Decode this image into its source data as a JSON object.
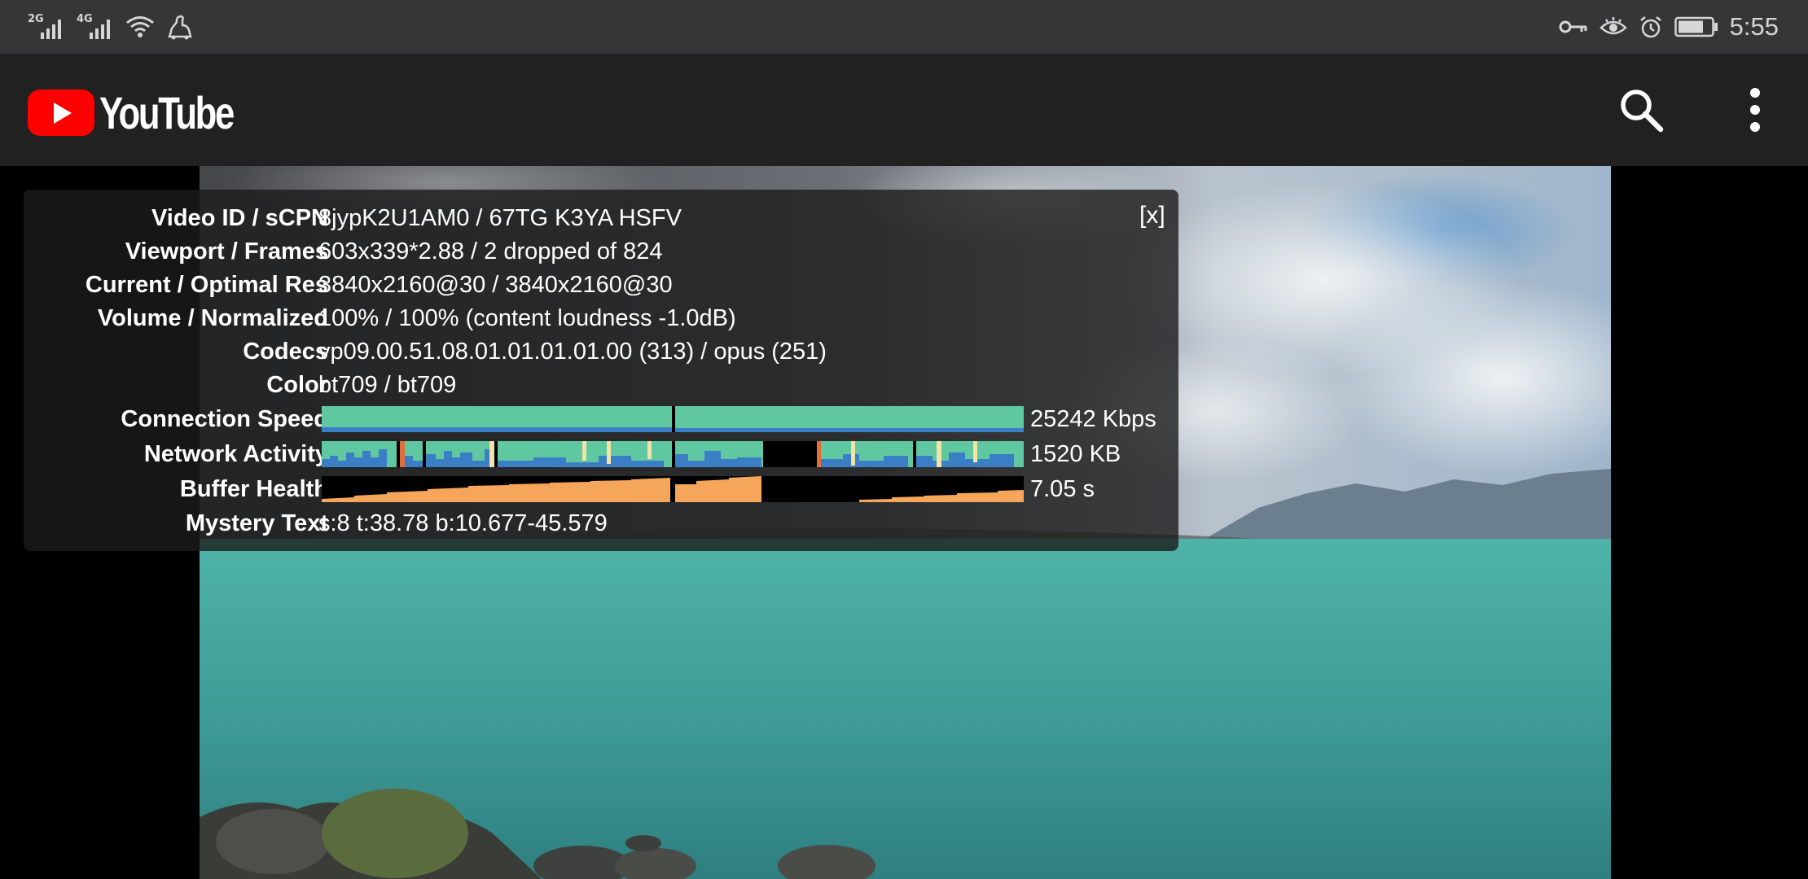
{
  "status_bar": {
    "signal_1_tag": "2G",
    "signal_2_tag": "4G",
    "time": "5:55",
    "icons": [
      "signal-2g-icon",
      "signal-4g-icon",
      "wifi-icon",
      "notification-icon",
      "vpn-key-icon",
      "eye-comfort-icon",
      "alarm-icon",
      "battery-icon"
    ]
  },
  "app_bar": {
    "logo_text": "YouTube",
    "brand_color": "#ff0000",
    "icons": [
      "search-icon",
      "more-vert-icon"
    ]
  },
  "stats": {
    "close_label": "[x]",
    "rows": [
      {
        "label": "Video ID / sCPN",
        "value": "8jypK2U1AM0 / 67TG K3YA HSFV"
      },
      {
        "label": "Viewport / Frames",
        "value": "603x339*2.88 / 2 dropped of 824"
      },
      {
        "label": "Current / Optimal Res",
        "value": "3840x2160@30 / 3840x2160@30"
      },
      {
        "label": "Volume / Normalized",
        "value": "100% / 100% (content loudness -1.0dB)"
      },
      {
        "label": "Codecs",
        "value": "vp09.00.51.08.01.01.01.01.00 (313) / opus (251)"
      },
      {
        "label": "Color",
        "value": "bt709 / bt709"
      }
    ],
    "graphs": [
      {
        "label": "Connection Speed",
        "value": "25242 Kbps"
      },
      {
        "label": "Network Activity",
        "value": "1520 KB"
      },
      {
        "label": "Buffer Health",
        "value": "7.05 s"
      }
    ],
    "mystery": {
      "label": "Mystery Text",
      "value": "s:8 t:38.78 b:10.677-45.579"
    },
    "colors": {
      "graph_teal": "#5fc8a0",
      "graph_blue": "#3a7fc6",
      "graph_orange": "#f6a65a",
      "graph_black": "#000000"
    }
  }
}
